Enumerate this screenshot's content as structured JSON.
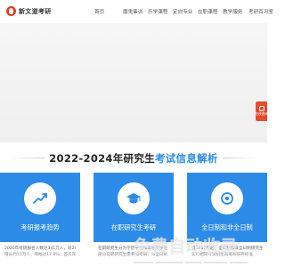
{
  "header": {
    "logo_text": "新文道考研",
    "nav": [
      {
        "label": "首页",
        "active": false
      },
      {
        "label": "魔鬼集训",
        "active": false
      },
      {
        "label": "乐学课程",
        "active": false
      },
      {
        "label": "定向专业",
        "active": false
      },
      {
        "label": "在职课程",
        "active": false
      },
      {
        "label": "教学服务",
        "active": false
      },
      {
        "label": "考研百习室",
        "active": false
      }
    ]
  },
  "side_widget": {
    "icon": "chat-icon",
    "label": "在线咨询"
  },
  "section": {
    "title_main": "2022-2024年研究生",
    "title_accent": "考试信息解析"
  },
  "cards": [
    {
      "title": "考研报考趋势",
      "icon": "trend-icon",
      "line1": "2020年考研报名人数达341万人，较2019年",
      "line2": "增长约51万人，增幅达17.8%，首次突破"
    },
    {
      "title": "在职研究生考研",
      "icon": "graduation-cap-icon",
      "line1": "在职研究生分为学历学位和非学历学位",
      "line2": "部分在职研究生需参加考研，与全日制"
    },
    {
      "title": "全日制和非全日制",
      "icon": "circle-icon",
      "line1": "自2017年起，全日制和非全日制研究生",
      "line2": "实行相同考试招生政策和培养标准"
    }
  ],
  "colors": {
    "brand_red": "#e03b26",
    "accent_blue": "#2d8be8"
  },
  "watermark": {
    "text": "免费自动收录"
  }
}
